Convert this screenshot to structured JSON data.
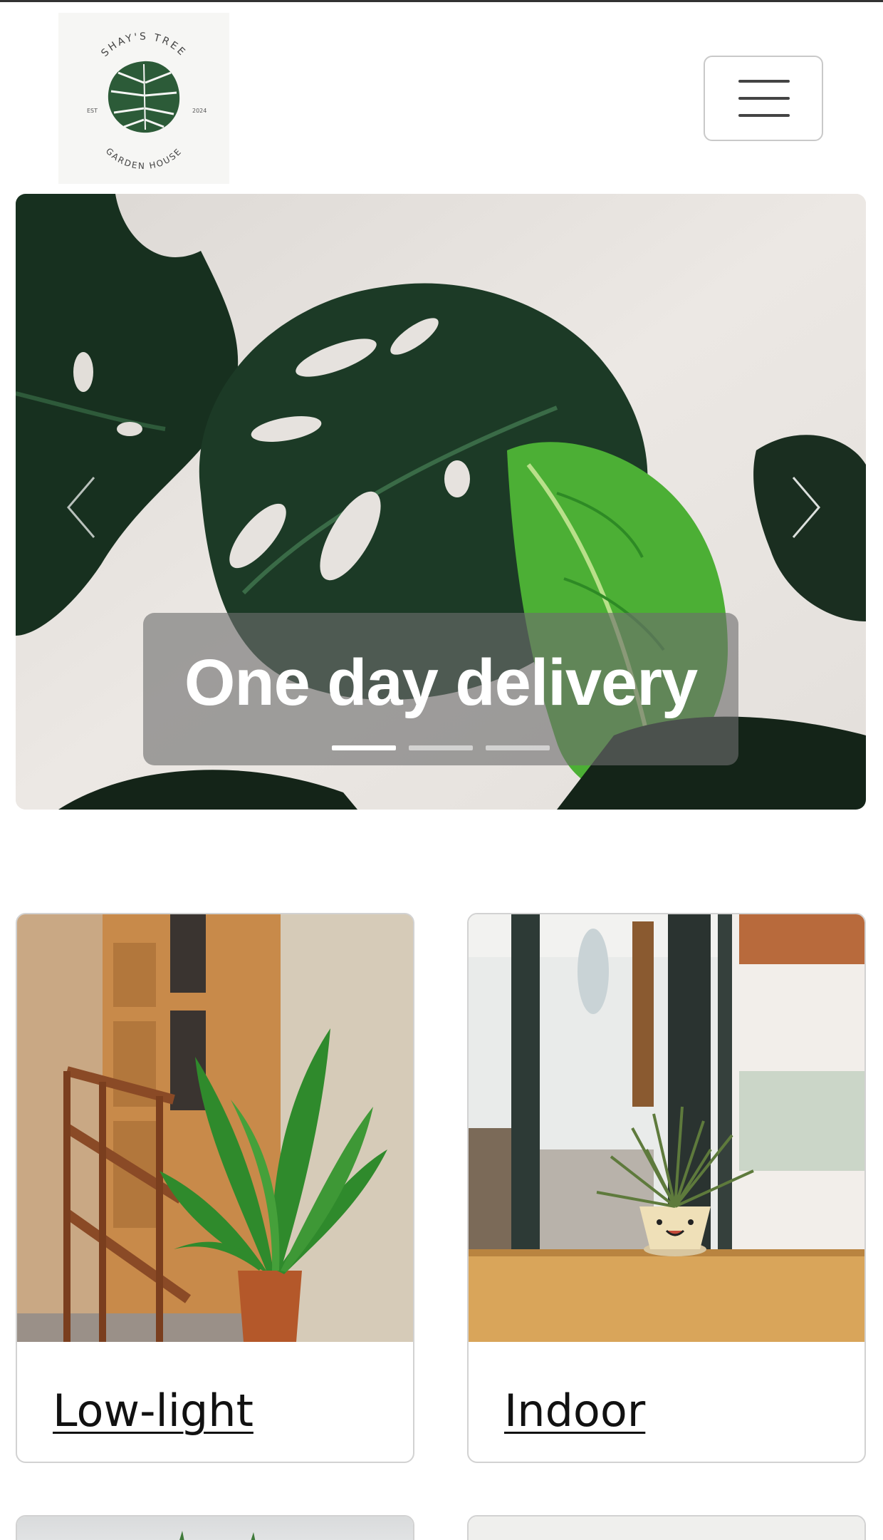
{
  "brand": {
    "logo_top_text": "SHAY'S TREE",
    "logo_bottom_text": "GARDEN HOUSE",
    "logo_est": "EST",
    "logo_year": "2024"
  },
  "header": {
    "menu_icon": "hamburger-menu-icon"
  },
  "hero": {
    "slides": [
      {
        "caption": "One day delivery"
      }
    ],
    "active_slide": 0,
    "slide_count": 3,
    "prev_icon": "chevron-left-icon",
    "next_icon": "chevron-right-icon"
  },
  "categories": [
    {
      "label": "Low-light"
    },
    {
      "label": "Indoor"
    }
  ],
  "colors": {
    "leaf_dark": "#1f3f2e",
    "leaf_light": "#4caf35",
    "caption_bg": "rgba(110,110,110,0.62)",
    "card_border": "#d2d2d2"
  }
}
